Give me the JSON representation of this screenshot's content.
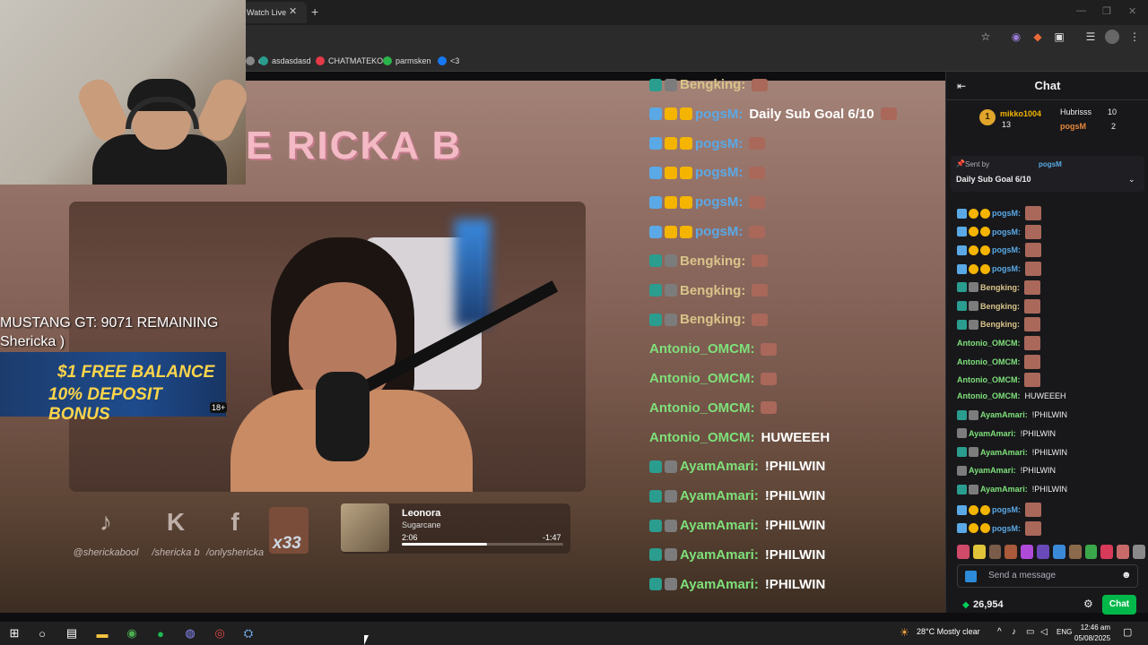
{
  "browser": {
    "tab_title": "Watch Live",
    "tab_close": "✕",
    "new_tab": "+",
    "bookmarks": [
      {
        "label": "d",
        "color": "#888888"
      },
      {
        "label": "asdasdasd",
        "color": "#2a9d8f"
      },
      {
        "label": "CHATMATEKO",
        "color": "#e63946"
      },
      {
        "label": "parmsken",
        "color": "#2bb34b"
      },
      {
        "label": "<3",
        "color": "#1877f2"
      }
    ]
  },
  "stream": {
    "banner_text": "E RICKA B",
    "goal_line1": "MUSTANG GT: 9071 REMAINING",
    "goal_line2": "Shericka  )",
    "ad_line1": "$1 FREE BALANCE",
    "ad_line2": "10% DEPOSIT BONUS",
    "ad_age": "18+",
    "socials": [
      {
        "icon": "tiktok-icon",
        "glyph": "♪",
        "handle": "@sherickabool"
      },
      {
        "icon": "kick-icon",
        "glyph": "K",
        "handle": "/shericka b"
      },
      {
        "icon": "facebook-icon",
        "glyph": "f",
        "handle": "/onlyshericka"
      }
    ],
    "x33_label": "x33",
    "music": {
      "title": "Leonora",
      "artist": "Sugarcane",
      "elapsed": "2:06",
      "remaining": "-1:47",
      "progress": 0.53
    }
  },
  "overlay_chat": [
    {
      "user": "Bengking:",
      "color": "#d9c48a",
      "message": "",
      "emote": true,
      "badges": [
        "#2a9d8f",
        "#7c7c7c"
      ]
    },
    {
      "user": "pogsM:",
      "color": "#5aa9e6",
      "message": "Daily Sub Goal 6/10",
      "emote": true,
      "badges": [
        "#5aa9e6",
        "#f4b400",
        "#f4b400"
      ]
    },
    {
      "user": "pogsM:",
      "color": "#5aa9e6",
      "message": "",
      "emote": true,
      "badges": [
        "#5aa9e6",
        "#f4b400",
        "#f4b400"
      ]
    },
    {
      "user": "pogsM:",
      "color": "#5aa9e6",
      "message": "",
      "emote": true,
      "badges": [
        "#5aa9e6",
        "#f4b400",
        "#f4b400"
      ]
    },
    {
      "user": "pogsM:",
      "color": "#5aa9e6",
      "message": "",
      "emote": true,
      "badges": [
        "#5aa9e6",
        "#f4b400",
        "#f4b400"
      ]
    },
    {
      "user": "pogsM:",
      "color": "#5aa9e6",
      "message": "",
      "emote": true,
      "badges": [
        "#5aa9e6",
        "#f4b400",
        "#f4b400"
      ]
    },
    {
      "user": "Bengking:",
      "color": "#d9c48a",
      "message": "",
      "emote": true,
      "badges": [
        "#2a9d8f",
        "#7c7c7c"
      ]
    },
    {
      "user": "Bengking:",
      "color": "#d9c48a",
      "message": "",
      "emote": true,
      "badges": [
        "#2a9d8f",
        "#7c7c7c"
      ]
    },
    {
      "user": "Bengking:",
      "color": "#d9c48a",
      "message": "",
      "emote": true,
      "badges": [
        "#2a9d8f",
        "#7c7c7c"
      ]
    },
    {
      "user": "Antonio_OMCM:",
      "color": "#7ee07a",
      "message": "",
      "emote": true,
      "badges": []
    },
    {
      "user": "Antonio_OMCM:",
      "color": "#7ee07a",
      "message": "",
      "emote": true,
      "badges": []
    },
    {
      "user": "Antonio_OMCM:",
      "color": "#7ee07a",
      "message": "",
      "emote": true,
      "badges": []
    },
    {
      "user": "Antonio_OMCM:",
      "color": "#7ee07a",
      "message": "HUWEEEH",
      "emote": false,
      "badges": []
    },
    {
      "user": "AyamAmari:",
      "color": "#7ee07a",
      "message": "!PHILWIN",
      "emote": false,
      "badges": [
        "#2a9d8f",
        "#7c7c7c"
      ]
    },
    {
      "user": "AyamAmari:",
      "color": "#7ee07a",
      "message": "!PHILWIN",
      "emote": false,
      "badges": [
        "#2a9d8f",
        "#7c7c7c"
      ]
    },
    {
      "user": "AyamAmari:",
      "color": "#7ee07a",
      "message": "!PHILWIN",
      "emote": false,
      "badges": [
        "#2a9d8f",
        "#7c7c7c"
      ]
    },
    {
      "user": "AyamAmari:",
      "color": "#7ee07a",
      "message": "!PHILWIN",
      "emote": false,
      "badges": [
        "#2a9d8f",
        "#7c7c7c"
      ]
    },
    {
      "user": "AyamAmari:",
      "color": "#7ee07a",
      "message": "!PHILWIN",
      "emote": false,
      "badges": [
        "#2a9d8f",
        "#7c7c7c"
      ]
    }
  ],
  "chat": {
    "title": "Chat",
    "leaderboard": {
      "first_user": "mikko1004",
      "first_count": "13",
      "second_user": "Hubrisss",
      "second_count": "10",
      "third_user": "pogsM",
      "third_count": "2"
    },
    "pinned": {
      "sent_by": "Sent by",
      "user": "pogsM",
      "message": "Daily Sub Goal 6/10"
    },
    "messages": [
      {
        "user": "pogsM:",
        "color": "#5aa9e6",
        "text": "",
        "emote": true,
        "badges": [
          "#5aa9e6",
          "#f4b400",
          "#f4b400"
        ]
      },
      {
        "user": "pogsM:",
        "color": "#5aa9e6",
        "text": "",
        "emote": true,
        "badges": [
          "#5aa9e6",
          "#f4b400",
          "#f4b400"
        ]
      },
      {
        "user": "pogsM:",
        "color": "#5aa9e6",
        "text": "",
        "emote": true,
        "badges": [
          "#5aa9e6",
          "#f4b400",
          "#f4b400"
        ]
      },
      {
        "user": "pogsM:",
        "color": "#5aa9e6",
        "text": "",
        "emote": true,
        "badges": [
          "#5aa9e6",
          "#f4b400",
          "#f4b400"
        ]
      },
      {
        "user": "Bengking:",
        "color": "#d9c48a",
        "text": "",
        "emote": true,
        "badges": [
          "#2a9d8f",
          "#7c7c7c"
        ]
      },
      {
        "user": "Bengking:",
        "color": "#d9c48a",
        "text": "",
        "emote": true,
        "badges": [
          "#2a9d8f",
          "#7c7c7c"
        ]
      },
      {
        "user": "Bengking:",
        "color": "#d9c48a",
        "text": "",
        "emote": true,
        "badges": [
          "#2a9d8f",
          "#7c7c7c"
        ]
      },
      {
        "user": "Antonio_OMCM:",
        "color": "#7ee07a",
        "text": "",
        "emote": true,
        "badges": []
      },
      {
        "user": "Antonio_OMCM:",
        "color": "#7ee07a",
        "text": "",
        "emote": true,
        "badges": []
      },
      {
        "user": "Antonio_OMCM:",
        "color": "#7ee07a",
        "text": "",
        "emote": true,
        "badges": []
      },
      {
        "user": "Antonio_OMCM:",
        "color": "#7ee07a",
        "text": "HUWEEEH",
        "emote": false,
        "badges": []
      },
      {
        "user": "AyamAmari:",
        "color": "#7ee07a",
        "text": "!PHILWIN",
        "emote": false,
        "badges": [
          "#2a9d8f",
          "#7c7c7c"
        ]
      },
      {
        "user": "AyamAmari:",
        "color": "#7ee07a",
        "text": "!PHILWIN",
        "emote": false,
        "badges": [
          "#7c7c7c"
        ]
      },
      {
        "user": "AyamAmari:",
        "color": "#7ee07a",
        "text": "!PHILWIN",
        "emote": false,
        "badges": [
          "#2a9d8f",
          "#7c7c7c"
        ]
      },
      {
        "user": "AyamAmari:",
        "color": "#7ee07a",
        "text": "!PHILWIN",
        "emote": false,
        "badges": [
          "#7c7c7c"
        ]
      },
      {
        "user": "AyamAmari:",
        "color": "#7ee07a",
        "text": "!PHILWIN",
        "emote": false,
        "badges": [
          "#2a9d8f",
          "#7c7c7c"
        ]
      },
      {
        "user": "pogsM:",
        "color": "#5aa9e6",
        "text": "",
        "emote": true,
        "badges": [
          "#5aa9e6",
          "#f4b400",
          "#f4b400"
        ]
      },
      {
        "user": "pogsM:",
        "color": "#5aa9e6",
        "text": "",
        "emote": true,
        "badges": [
          "#5aa9e6",
          "#f4b400",
          "#f4b400"
        ]
      }
    ],
    "emote_colors": [
      "#d04a6a",
      "#e0c43a",
      "#7a5c4a",
      "#a85a3a",
      "#b04ad8",
      "#6a4ab8",
      "#3a8ad8",
      "#8a6a4a",
      "#3aa84a",
      "#d83a5a",
      "#c86a6a",
      "#8a8a8a"
    ],
    "input_placeholder": "Send a message",
    "points": "26,954",
    "chat_button": "Chat",
    "accent": "#00b849"
  },
  "taskbar": {
    "weather": "28°C  Mostly clear",
    "lang": "ENG",
    "time": "12:46 am",
    "date": "05/08/2025"
  }
}
